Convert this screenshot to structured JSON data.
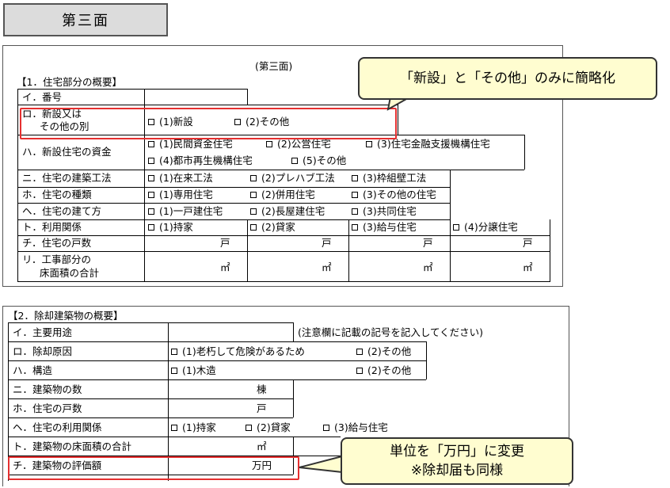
{
  "page_title": "第三面",
  "sheet_caption": "(第三面)",
  "section1": {
    "heading": "【1．住宅部分の概要】",
    "rows": {
      "i_label": "イ．番号",
      "ro_label_1": "ロ．新設又は",
      "ro_label_2": "その他の別",
      "ro_opt1": "(1)新設",
      "ro_opt2": "(2)その他",
      "ha_label": "ハ．新設住宅の資金",
      "ha_opt1": "(1)民間資金住宅",
      "ha_opt2": "(2)公営住宅",
      "ha_opt3": "(3)住宅金融支援機構住宅",
      "ha_opt4": "(4)都市再生機構住宅",
      "ha_opt5": "(5)その他",
      "ni_label": "ニ．住宅の建築工法",
      "ni_opt1": "(1)在来工法",
      "ni_opt2": "(2)プレハブ工法",
      "ni_opt3": "(3)枠組壁工法",
      "ho_label": "ホ．住宅の種類",
      "ho_opt1": "(1)専用住宅",
      "ho_opt2": "(2)併用住宅",
      "ho_opt3": "(3)その他の住宅",
      "he_label": "ヘ．住宅の建て方",
      "he_opt1": "(1)一戸建住宅",
      "he_opt2": "(2)長屋建住宅",
      "he_opt3": "(3)共同住宅",
      "to_label": "ト．利用関係",
      "to_opt1": "(1)持家",
      "to_opt2": "(2)貸家",
      "to_opt3": "(3)給与住宅",
      "to_opt4": "(4)分譲住宅",
      "chi_label": "チ．住宅の戸数",
      "unit_ko": "戸",
      "ri_label_1": "リ．工事部分の",
      "ri_label_2": "床面積の合計",
      "unit_m2": "㎡"
    }
  },
  "section2": {
    "heading": "【2．除却建築物の概要】",
    "rows": {
      "i_label": "イ．主要用途",
      "i_note": "(注意欄に記載の記号を記入してください)",
      "ro_label": "ロ．除却原因",
      "ro_opt1": "(1)老朽して危険があるため",
      "ro_opt2": "(2)その他",
      "ha_label": "ハ．構造",
      "ha_opt1": "(1)木造",
      "ha_opt2": "(2)その他",
      "ni_label": "ニ．建築物の数",
      "unit_mune": "棟",
      "ho_label": "ホ．住宅の戸数",
      "unit_ko": "戸",
      "he_label": "ヘ．住宅の利用関係",
      "he_opt1": "(1)持家",
      "he_opt2": "(2)貸家",
      "he_opt3": "(3)給与住宅",
      "to_label": "ト．建築物の床面積の合計",
      "unit_m2": "㎡",
      "chi_label": "チ．建築物の評価額",
      "unit_manen": "万円"
    }
  },
  "callout1": "「新設」と「その他」のみに簡略化",
  "callout2_line1": "単位を「万円」に変更",
  "callout2_line2": "※除却届も同様",
  "colors": {
    "highlight": "#e53030",
    "callout_bg": "#fffdd0",
    "title_bg": "#dcdcdc"
  }
}
